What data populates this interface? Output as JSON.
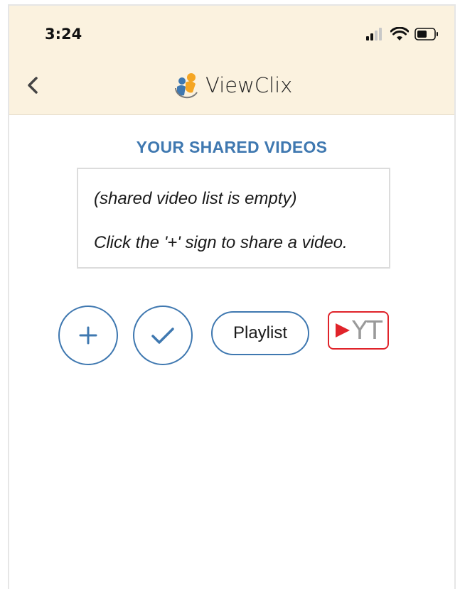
{
  "status_bar": {
    "time": "3:24"
  },
  "header": {
    "logo_text": "ViewClix"
  },
  "main": {
    "title": "YOUR SHARED VIDEOS",
    "empty_message": "(shared video list is empty)",
    "hint_message": "Click the '+' sign to share a video."
  },
  "actions": {
    "playlist_label": "Playlist",
    "youtube_label": "YT"
  },
  "colors": {
    "header_bg": "#fbf2df",
    "accent_blue": "#3f78b0",
    "youtube_red": "#e0232a"
  }
}
